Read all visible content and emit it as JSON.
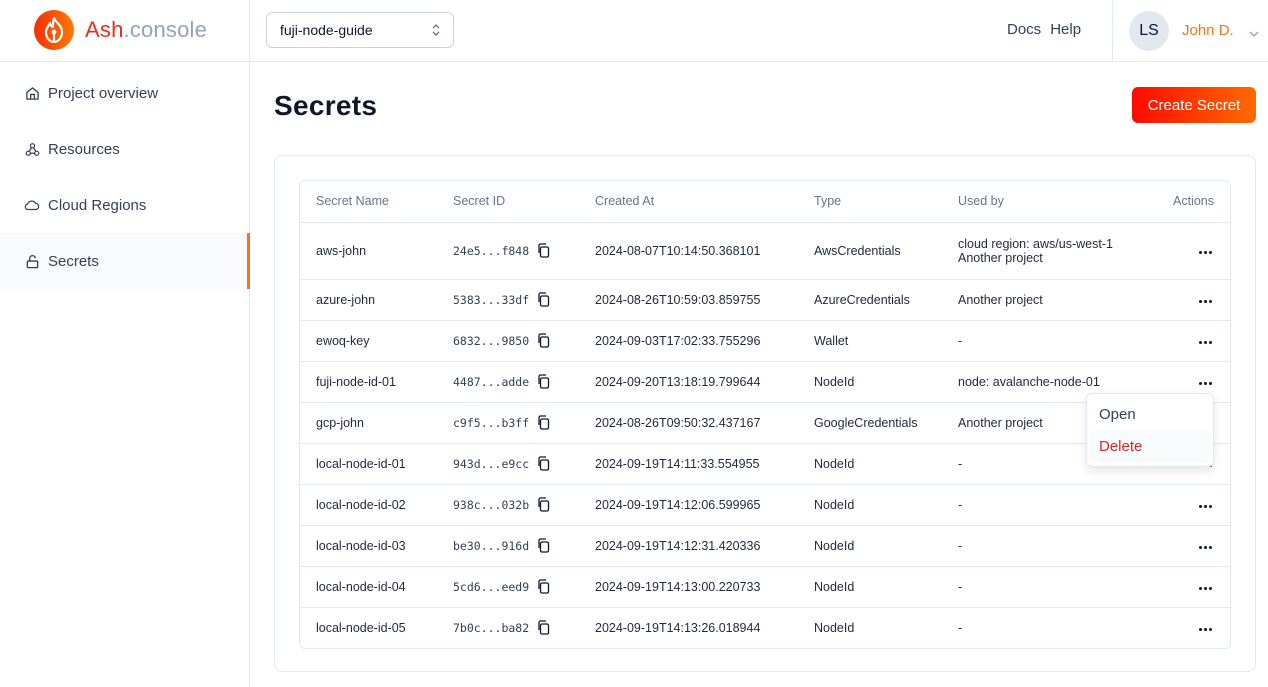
{
  "brand": {
    "name_main": "Ash",
    "name_suffix": ".console"
  },
  "header": {
    "project_select": {
      "value": "fuji-node-guide"
    },
    "links": [
      "Docs",
      "Help"
    ],
    "user": {
      "initials": "LS",
      "name": "John D."
    }
  },
  "sidebar": {
    "items": [
      {
        "label": "Project overview",
        "icon": "home-icon"
      },
      {
        "label": "Resources",
        "icon": "webhook-icon"
      },
      {
        "label": "Cloud Regions",
        "icon": "cloud-icon"
      },
      {
        "label": "Secrets",
        "icon": "unlock-icon",
        "active": true
      }
    ]
  },
  "page": {
    "title": "Secrets",
    "create_button": "Create Secret"
  },
  "table": {
    "headers": [
      "Secret Name",
      "Secret ID",
      "Created At",
      "Type",
      "Used by",
      "Actions"
    ],
    "rows": [
      {
        "name": "aws-john",
        "id": "24e5...f848",
        "created": "2024-08-07T10:14:50.368101",
        "type": "AwsCredentials",
        "used_by": [
          "cloud region: aws/us-west-1",
          "Another project"
        ]
      },
      {
        "name": "azure-john",
        "id": "5383...33df",
        "created": "2024-08-26T10:59:03.859755",
        "type": "AzureCredentials",
        "used_by": [
          "Another project"
        ]
      },
      {
        "name": "ewoq-key",
        "id": "6832...9850",
        "created": "2024-09-03T17:02:33.755296",
        "type": "Wallet",
        "used_by": [
          "-"
        ]
      },
      {
        "name": "fuji-node-id-01",
        "id": "4487...adde",
        "created": "2024-09-20T13:18:19.799644",
        "type": "NodeId",
        "used_by": [
          "node: avalanche-node-01"
        ]
      },
      {
        "name": "gcp-john",
        "id": "c9f5...b3ff",
        "created": "2024-08-26T09:50:32.437167",
        "type": "GoogleCredentials",
        "used_by": [
          "Another project"
        ]
      },
      {
        "name": "local-node-id-01",
        "id": "943d...e9cc",
        "created": "2024-09-19T14:11:33.554955",
        "type": "NodeId",
        "used_by": [
          "-"
        ]
      },
      {
        "name": "local-node-id-02",
        "id": "938c...032b",
        "created": "2024-09-19T14:12:06.599965",
        "type": "NodeId",
        "used_by": [
          "-"
        ]
      },
      {
        "name": "local-node-id-03",
        "id": "be30...916d",
        "created": "2024-09-19T14:12:31.420336",
        "type": "NodeId",
        "used_by": [
          "-"
        ]
      },
      {
        "name": "local-node-id-04",
        "id": "5cd6...eed9",
        "created": "2024-09-19T14:13:00.220733",
        "type": "NodeId",
        "used_by": [
          "-"
        ]
      },
      {
        "name": "local-node-id-05",
        "id": "7b0c...ba82",
        "created": "2024-09-19T14:13:26.018944",
        "type": "NodeId",
        "used_by": [
          "-"
        ]
      }
    ]
  },
  "context_menu": {
    "items": [
      "Open",
      "Delete"
    ],
    "danger_color": "#dc2626"
  },
  "colors": {
    "accent": "#f97316",
    "brand_red": "#ef2b1a",
    "button_gradient_start": "#ff0a00",
    "button_gradient_end": "#ff6a00"
  }
}
